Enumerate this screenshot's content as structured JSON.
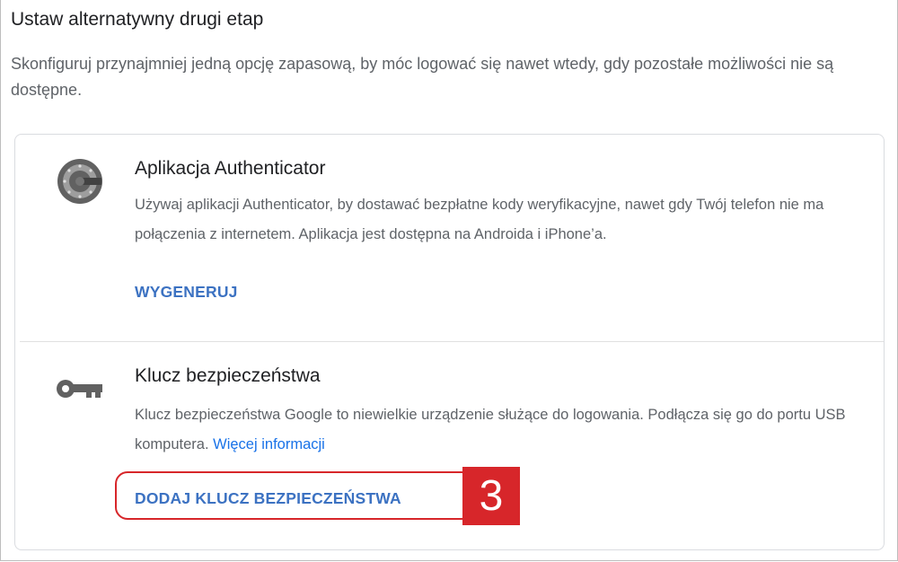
{
  "section": {
    "title": "Ustaw alternatywny drugi etap",
    "description": "Skonfiguruj przynajmniej jedną opcję zapasową, by móc logować się nawet wtedy, gdy pozostałe możliwości nie są dostępne."
  },
  "options": [
    {
      "icon": "authenticator-icon",
      "title": "Aplikacja Authenticator",
      "description": "Używaj aplikacji Authenticator, by dostawać bezpłatne kody weryfikacyjne, nawet gdy Twój telefon nie ma połączenia z internetem. Aplikacja jest dostępna na Androida i iPhone’a.",
      "action": "WYGENERUJ"
    },
    {
      "icon": "key-icon",
      "title": "Klucz bezpieczeństwa",
      "description": "Klucz bezpieczeństwa Google to niewielkie urządzenie służące do logowania. Podłącza się go do portu USB komputera.",
      "link": "Więcej informacji",
      "action": "DODAJ KLUCZ BEZPIECZEŃSTWA"
    }
  ],
  "annotation": {
    "step_number": "3",
    "color": "#d7262a"
  },
  "colors": {
    "link": "#1a73e8",
    "action": "#3c72c2",
    "text_secondary": "#5f6368"
  }
}
